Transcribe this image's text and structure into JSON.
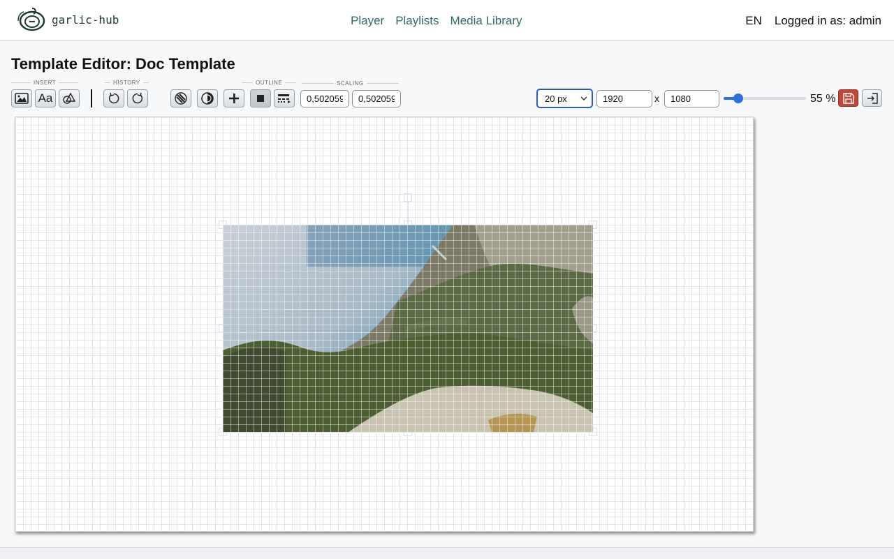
{
  "brand": {
    "name": "garlic-hub"
  },
  "nav": {
    "items": [
      "Player",
      "Playlists",
      "Media Library"
    ]
  },
  "header": {
    "language": "EN",
    "user": "Logged in as: admin"
  },
  "page": {
    "title": "Template Editor: Doc Template"
  },
  "toolbar": {
    "groups": {
      "insert": "INSERT",
      "history": "HISTORY",
      "outline": "OUTLINE",
      "scaling": "SCALING"
    },
    "insert_text_label": "Aa",
    "scale_x": "0,502059",
    "scale_y": "0,502059",
    "grid_size": "20 px",
    "width": "1920",
    "height": "1080",
    "dimension_separator": "x",
    "zoom_percent": 55,
    "zoom_label": "55 %"
  },
  "colors": {
    "nav_link": "#2e6b68",
    "save_button": "#c0483a",
    "slider": "#2f6fe0",
    "select_focus": "#2f5bb7"
  },
  "icons": {
    "insert": [
      "image-icon",
      "text-icon",
      "shapes-icon"
    ],
    "history": [
      "undo-icon",
      "redo-icon"
    ],
    "tools": [
      "layer-icon",
      "contrast-icon",
      "add-icon",
      "outline-square-icon",
      "outline-style-icon"
    ],
    "right": [
      "save-icon",
      "exit-icon"
    ]
  }
}
